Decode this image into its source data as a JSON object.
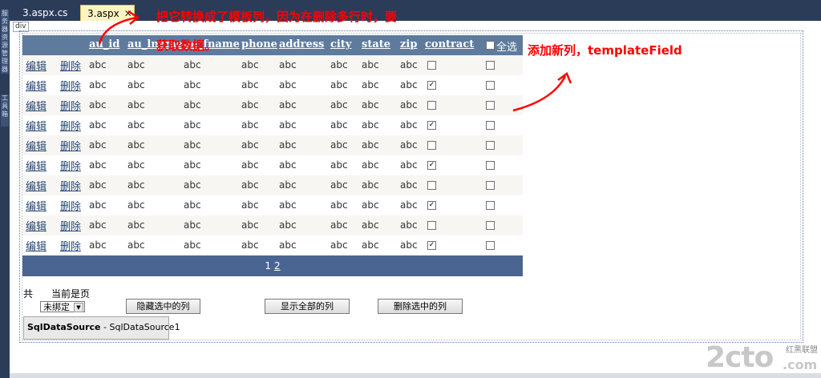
{
  "tabs": [
    {
      "label": "3.aspx.cs"
    },
    {
      "label": "3.aspx",
      "close": "✕"
    }
  ],
  "left_toolbar": [
    "服务器资源管理器",
    "工具箱"
  ],
  "div_tag": "div",
  "grid": {
    "headers": [
      "au_id",
      "au_lname",
      "au_fname",
      "phone",
      "address",
      "city",
      "state",
      "zip",
      "contract",
      "全选"
    ],
    "edit_label": "编辑",
    "delete_label": "删除",
    "cell_value": "abc",
    "rows": [
      {
        "contract": false
      },
      {
        "contract": true
      },
      {
        "contract": false
      },
      {
        "contract": true
      },
      {
        "contract": false
      },
      {
        "contract": true
      },
      {
        "contract": false
      },
      {
        "contract": true
      },
      {
        "contract": false
      },
      {
        "contract": true
      }
    ],
    "pager": {
      "current": "1",
      "next": "2"
    }
  },
  "footer": {
    "total_label": "共",
    "current_page_label": "当前是页",
    "select_value": "未绑定",
    "buttons": [
      "隐藏选中的列",
      "显示全部的列",
      "删除选中的列"
    ]
  },
  "datasource": {
    "type": "SqlDataSource",
    "sep": " - ",
    "id": "SqlDataSource1"
  },
  "annotations": {
    "top_line1": "把它转换成了模板列，因为在删除多行时，要",
    "top_line2": "获取数据。",
    "right": "添加新列，templateField"
  },
  "watermark": {
    "main": "2cto",
    "small": "红黑联盟",
    "domain": ".com"
  },
  "colors": {
    "header": "#5e7b9d",
    "pager": "#4a6591",
    "annotation": "#ff0000",
    "link": "#284775"
  }
}
